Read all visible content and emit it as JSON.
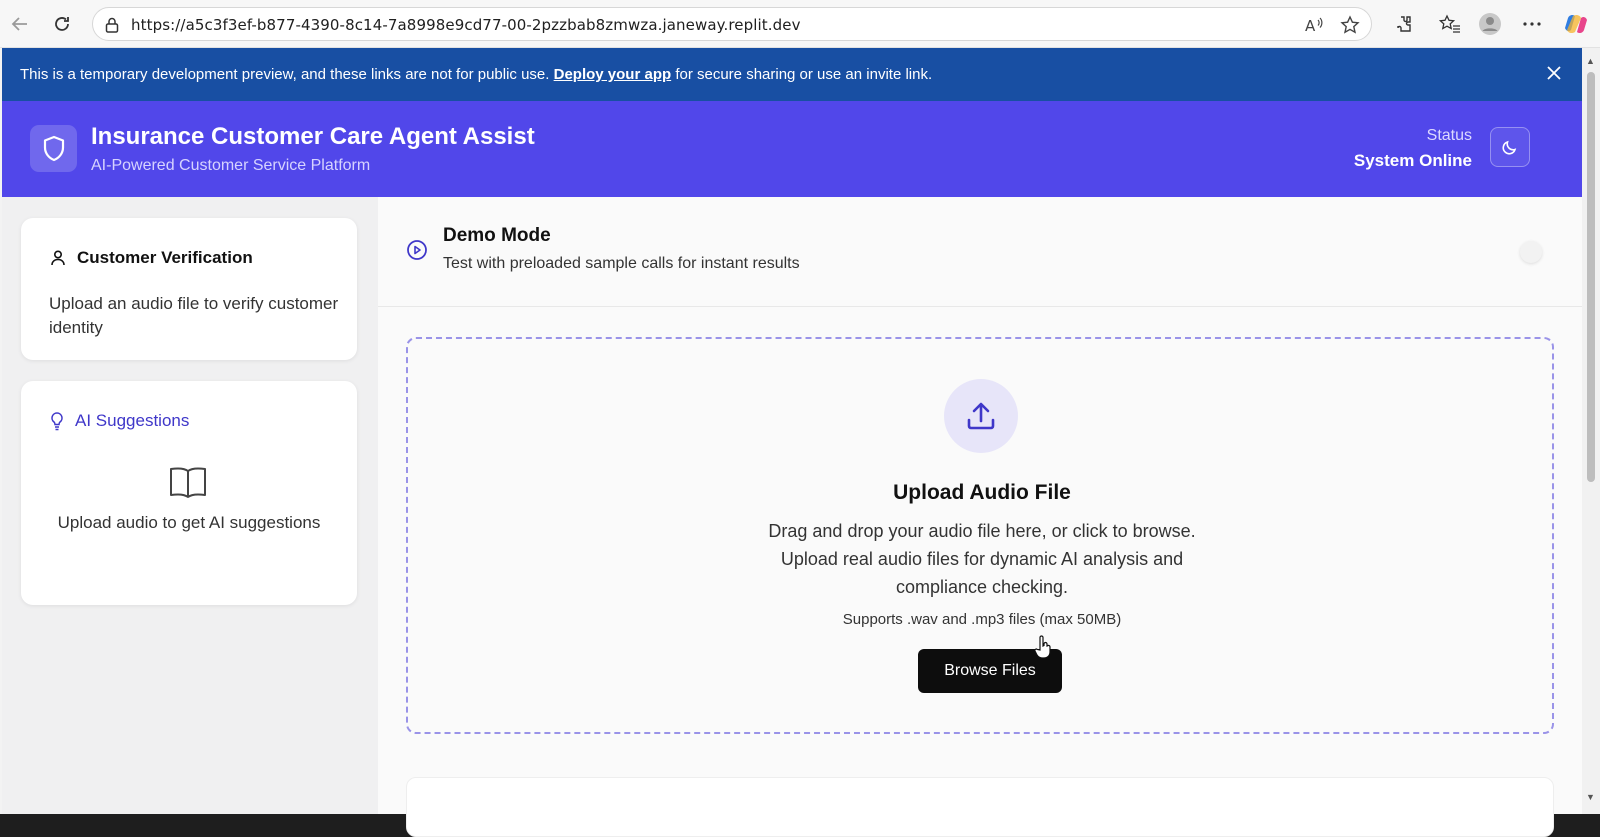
{
  "browser": {
    "url": "https://a5c3f3ef-b877-4390-8c14-7a8998e9cd77-00-2pzzbab8zmwza.janeway.replit.dev"
  },
  "banner": {
    "text_before": "This is a temporary development preview, and these links are not for public use.",
    "link_text": "Deploy your app",
    "text_after": "for secure sharing or use an invite link."
  },
  "header": {
    "title": "Insurance Customer Care Agent Assist",
    "subtitle": "AI-Powered Customer Service Platform",
    "status_label": "Status",
    "status_value": "System Online"
  },
  "sidebar": {
    "verification": {
      "title": "Customer Verification",
      "description": "Upload an audio file to verify customer identity"
    },
    "suggestions": {
      "title": "AI Suggestions",
      "empty_text": "Upload audio to get AI suggestions"
    }
  },
  "demo": {
    "title": "Demo Mode",
    "subtitle": "Test with preloaded sample calls for instant results",
    "enabled": false
  },
  "upload": {
    "title": "Upload Audio File",
    "description": "Drag and drop your audio file here, or click to browse. Upload real audio files for dynamic AI analysis and compliance checking.",
    "supports": "Supports .wav and .mp3 files (max 50MB)",
    "button_label": "Browse Files"
  },
  "colors": {
    "banner_bg": "#184fa3",
    "header_bg": "#5147ea",
    "accent": "#3f37c9",
    "dropzone_border": "#9a93e8"
  }
}
